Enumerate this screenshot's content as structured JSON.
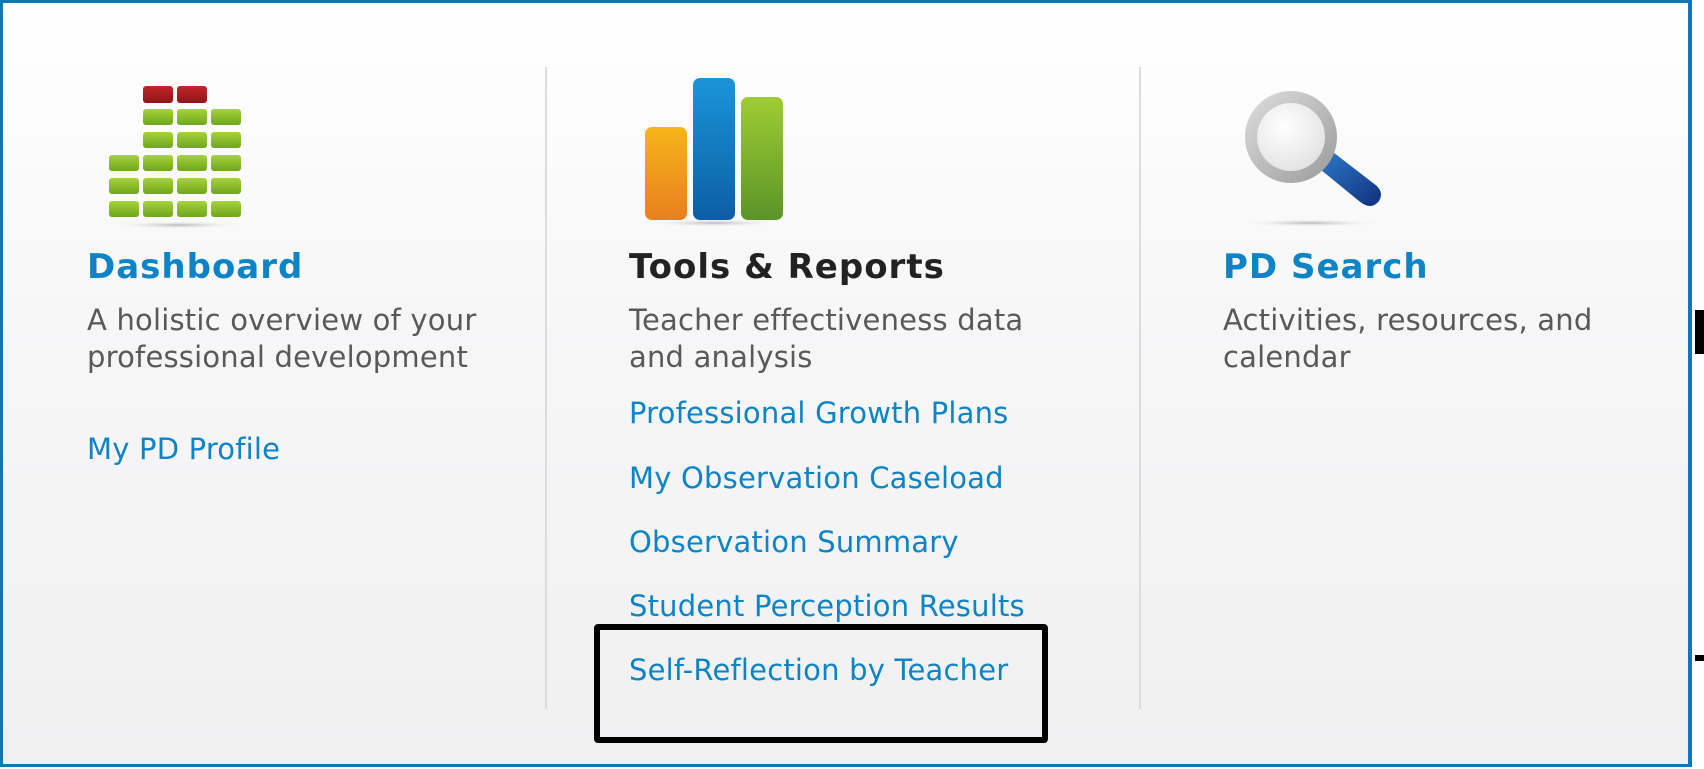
{
  "columns": {
    "dashboard": {
      "icon": "equalizer-bars-icon",
      "heading": "Dashboard",
      "description": "A holistic overview of your professional development",
      "links": [
        "My PD Profile"
      ]
    },
    "tools_reports": {
      "icon": "bar-chart-icon",
      "heading": "Tools & Reports",
      "description": "Teacher effectiveness data and analysis",
      "links": [
        "Professional Growth Plans",
        "My Observation Caseload",
        "Observation Summary",
        "Student Perception Results",
        "Self-Reflection by Teacher"
      ]
    },
    "pd_search": {
      "icon": "magnifying-glass-icon",
      "heading": "PD Search",
      "description": "Activities, resources, and calendar",
      "links": []
    }
  },
  "colors": {
    "panel_border": "#0f77b6",
    "link": "#0c84c6",
    "heading_plain": "#222222",
    "description": "#595959",
    "highlight": "#000000"
  }
}
